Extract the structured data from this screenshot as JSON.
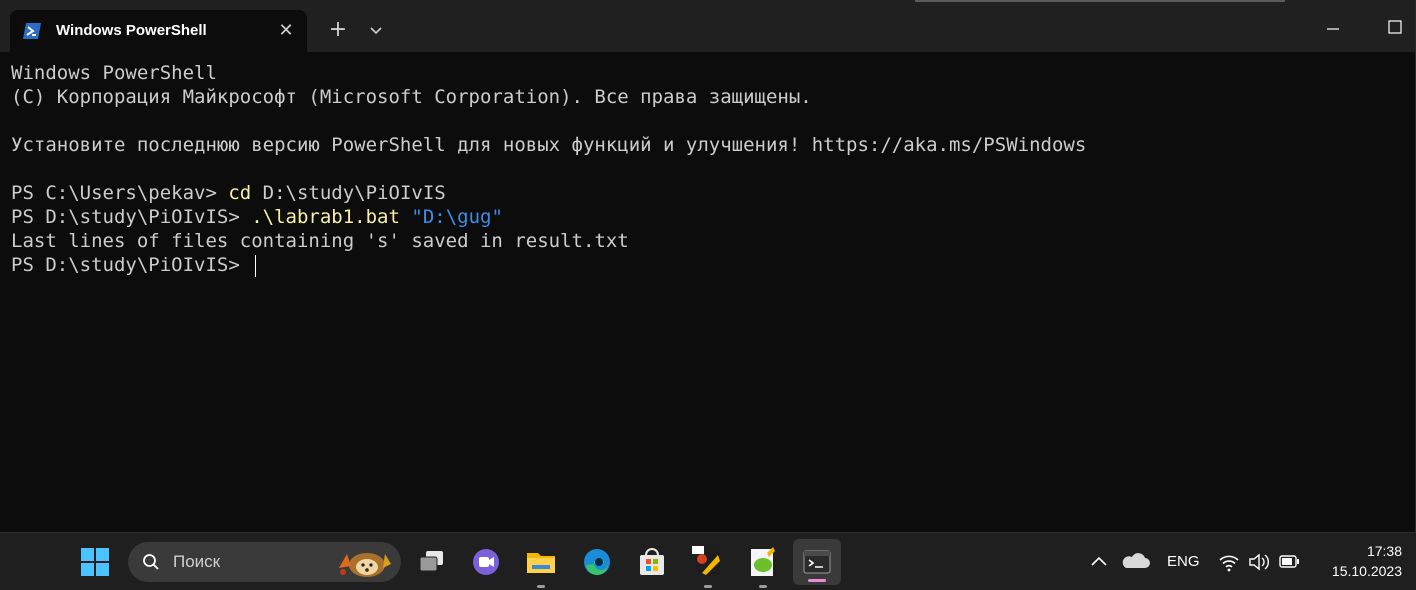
{
  "window": {
    "tab_title": "Windows PowerShell",
    "tab_close": "✕",
    "new_tab": "+"
  },
  "terminal": {
    "lines": [
      "Windows PowerShell",
      "(C) Корпорация Майкрософт (Microsoft Corporation). Все права защищены.",
      "",
      "Установите последнюю версию PowerShell для новых функций и улучшения! https://aka.ms/PSWindows",
      "",
      "PS C:\\Users\\pekav> ",
      "PS D:\\study\\PiOIvIS> ",
      "Last lines of files containing 's' saved in result.txt",
      "PS D:\\study\\PiOIvIS> "
    ],
    "cmd1_keyword": "cd",
    "cmd1_arg": " D:\\study\\PiOIvIS",
    "cmd2_keyword": ".\\labrab1.bat",
    "cmd2_arg": " \"D:\\gug\""
  },
  "taskbar": {
    "search_placeholder": "Поиск",
    "language": "ENG",
    "time": "17:38",
    "date": "15.10.2023"
  },
  "colors": {
    "terminal_bg": "#0c0c0c",
    "titlebar_bg": "#202020",
    "command_yellow": "#f9f1a5",
    "string_blue": "#3b8eea",
    "accent_terminal_indicator": "#e68fd4"
  }
}
